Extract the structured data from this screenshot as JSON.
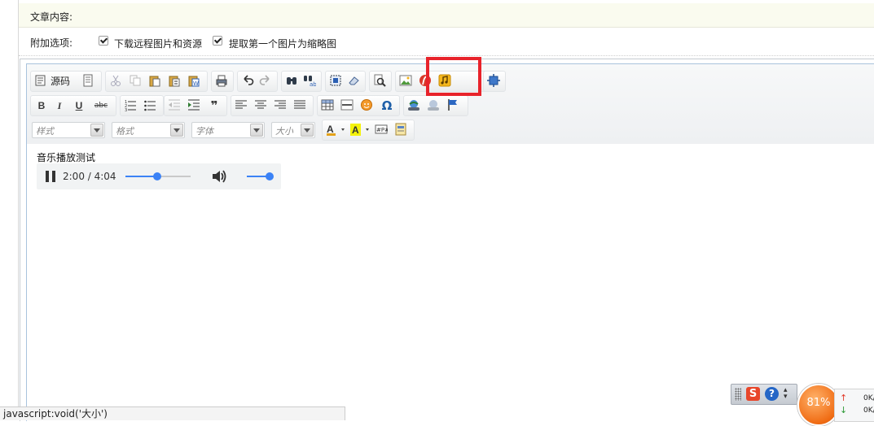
{
  "form": {
    "content_label": "文章内容:",
    "options_label": "附加选项:",
    "options": [
      {
        "label": "下载远程图片和资源",
        "checked": true
      },
      {
        "label": "提取第一个图片为缩略图",
        "checked": true
      }
    ]
  },
  "toolbar": {
    "source_label": "源码",
    "combos": {
      "style": "样式",
      "format": "格式",
      "font": "字体",
      "size": "大小"
    },
    "icons": {
      "bold": "B",
      "italic": "I",
      "underline": "U",
      "strike": "abc",
      "omega": "Ω",
      "quote": "❞"
    }
  },
  "editor": {
    "content_title": "音乐播放测试",
    "audio": {
      "time": "2:00 / 4:04",
      "progress_fraction": 0.49,
      "volume_fraction": 1.0
    }
  },
  "statusbar": {
    "text": "javascript:void('大小')"
  },
  "tray": {
    "ime_s": "S",
    "ime_help": "?",
    "net_percent": "81%",
    "up_rate": "0K/",
    "down_rate": "0K/",
    "up_arrow": "↑",
    "down_arrow": "↓"
  },
  "colors": {
    "accent": "#3b82f6",
    "highlight": "#e8232b",
    "net_ball": "#f06c14"
  }
}
